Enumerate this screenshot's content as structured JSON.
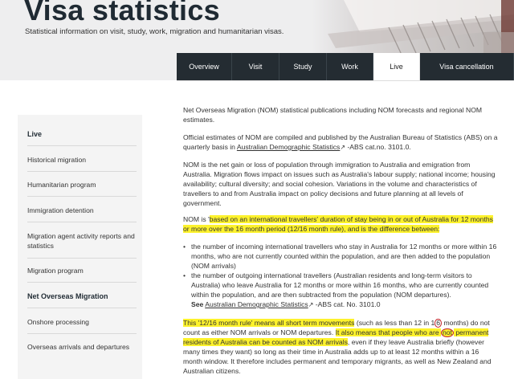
{
  "header": {
    "title": "Visa statistics",
    "subtitle": "Statistical information on visit, study, work, migration and humanitarian visas."
  },
  "tabs": [
    {
      "label": "Overview"
    },
    {
      "label": "Visit"
    },
    {
      "label": "Study"
    },
    {
      "label": "Work"
    },
    {
      "label": "Live"
    },
    {
      "label": "Visa cancellation"
    }
  ],
  "sidebar": {
    "heading": "Live",
    "items": [
      {
        "label": "Historical migration"
      },
      {
        "label": "Humanitarian program"
      },
      {
        "label": "Immigration detention"
      },
      {
        "label": "Migration agent activity reports and statistics"
      },
      {
        "label": "Migration program"
      },
      {
        "label": "Net Overseas Migration"
      },
      {
        "label": "Onshore processing"
      },
      {
        "label": "Overseas arrivals and departures"
      }
    ]
  },
  "content": {
    "p1": "Net Overseas Migration (NOM) statistical publications including NOM forecasts and regional NOM estimates.",
    "p2_before": "Official estimates of NOM are compiled and published by the Australian Bureau of Statistics (ABS) on a quarterly basis in ",
    "p2_link": "Australian Demographic Statistics",
    "p2_after": " -ABS cat.no. 3101.0.",
    "p3": "NOM is the net gain or loss of population through immigration to Australia and emigration from Australia. Migration flows impact on issues such as Australia's labour supply; national income; housing availability; cultural diversity; and social cohesion. Variations in the volume and characteristics of travellers to and from Australia impact on policy decisions and future planning at all levels of government.",
    "p4_before": "NOM is '",
    "p4_highlight": "based on an international travellers' duration of stay being in or out of Australia for 12 months or more over the 16 month period (12/16 month rule), and is the difference between:",
    "bullet1": "the number of incoming international travellers who stay in Australia for 12 months or more within 16 months, who are not currently counted within the population, and are then added to the population (NOM arrivals)",
    "bullet2": "the number of outgoing international travellers (Australian residents and long-term visitors to Australia) who leave Australia for 12 months or more within 16 months, who are currently counted within the population, and are then subtracted from the population (NOM departures).",
    "see_label": "See",
    "see_link": "Australian Demographic Statistics",
    "see_after": " -ABS cat. No. 3101.0",
    "p5_hl1": "This '12/16 month rule' means all short term movements",
    "p5_mid1": " (such as less than 12 in 1",
    "p5_circle1": "6",
    "p5_mid2": " months) do not count as either NOM arrivals or NOM departures. ",
    "p5_hl2a": "It also means that people who are ",
    "p5_circle2": "not",
    "p5_hl2b": " permanent residents of Australia can be counted as NOM arrivals",
    "p5_after": ", even if they leave Australia briefly (however many times they want) so long as their time in Australia adds up to at least 12 months within a 16 month window. It therefore includes permanent and temporary migrants, as well as New Zealand and Australian citizens."
  },
  "colors": {
    "tab_bg": "#242c32",
    "highlight": "#fdf22c",
    "sidebar_bg": "#f4f4f4",
    "header_bg": "#eeeeef",
    "annotation_circle": "#c3252b"
  },
  "icons": {
    "external_link": "external-link-icon"
  }
}
